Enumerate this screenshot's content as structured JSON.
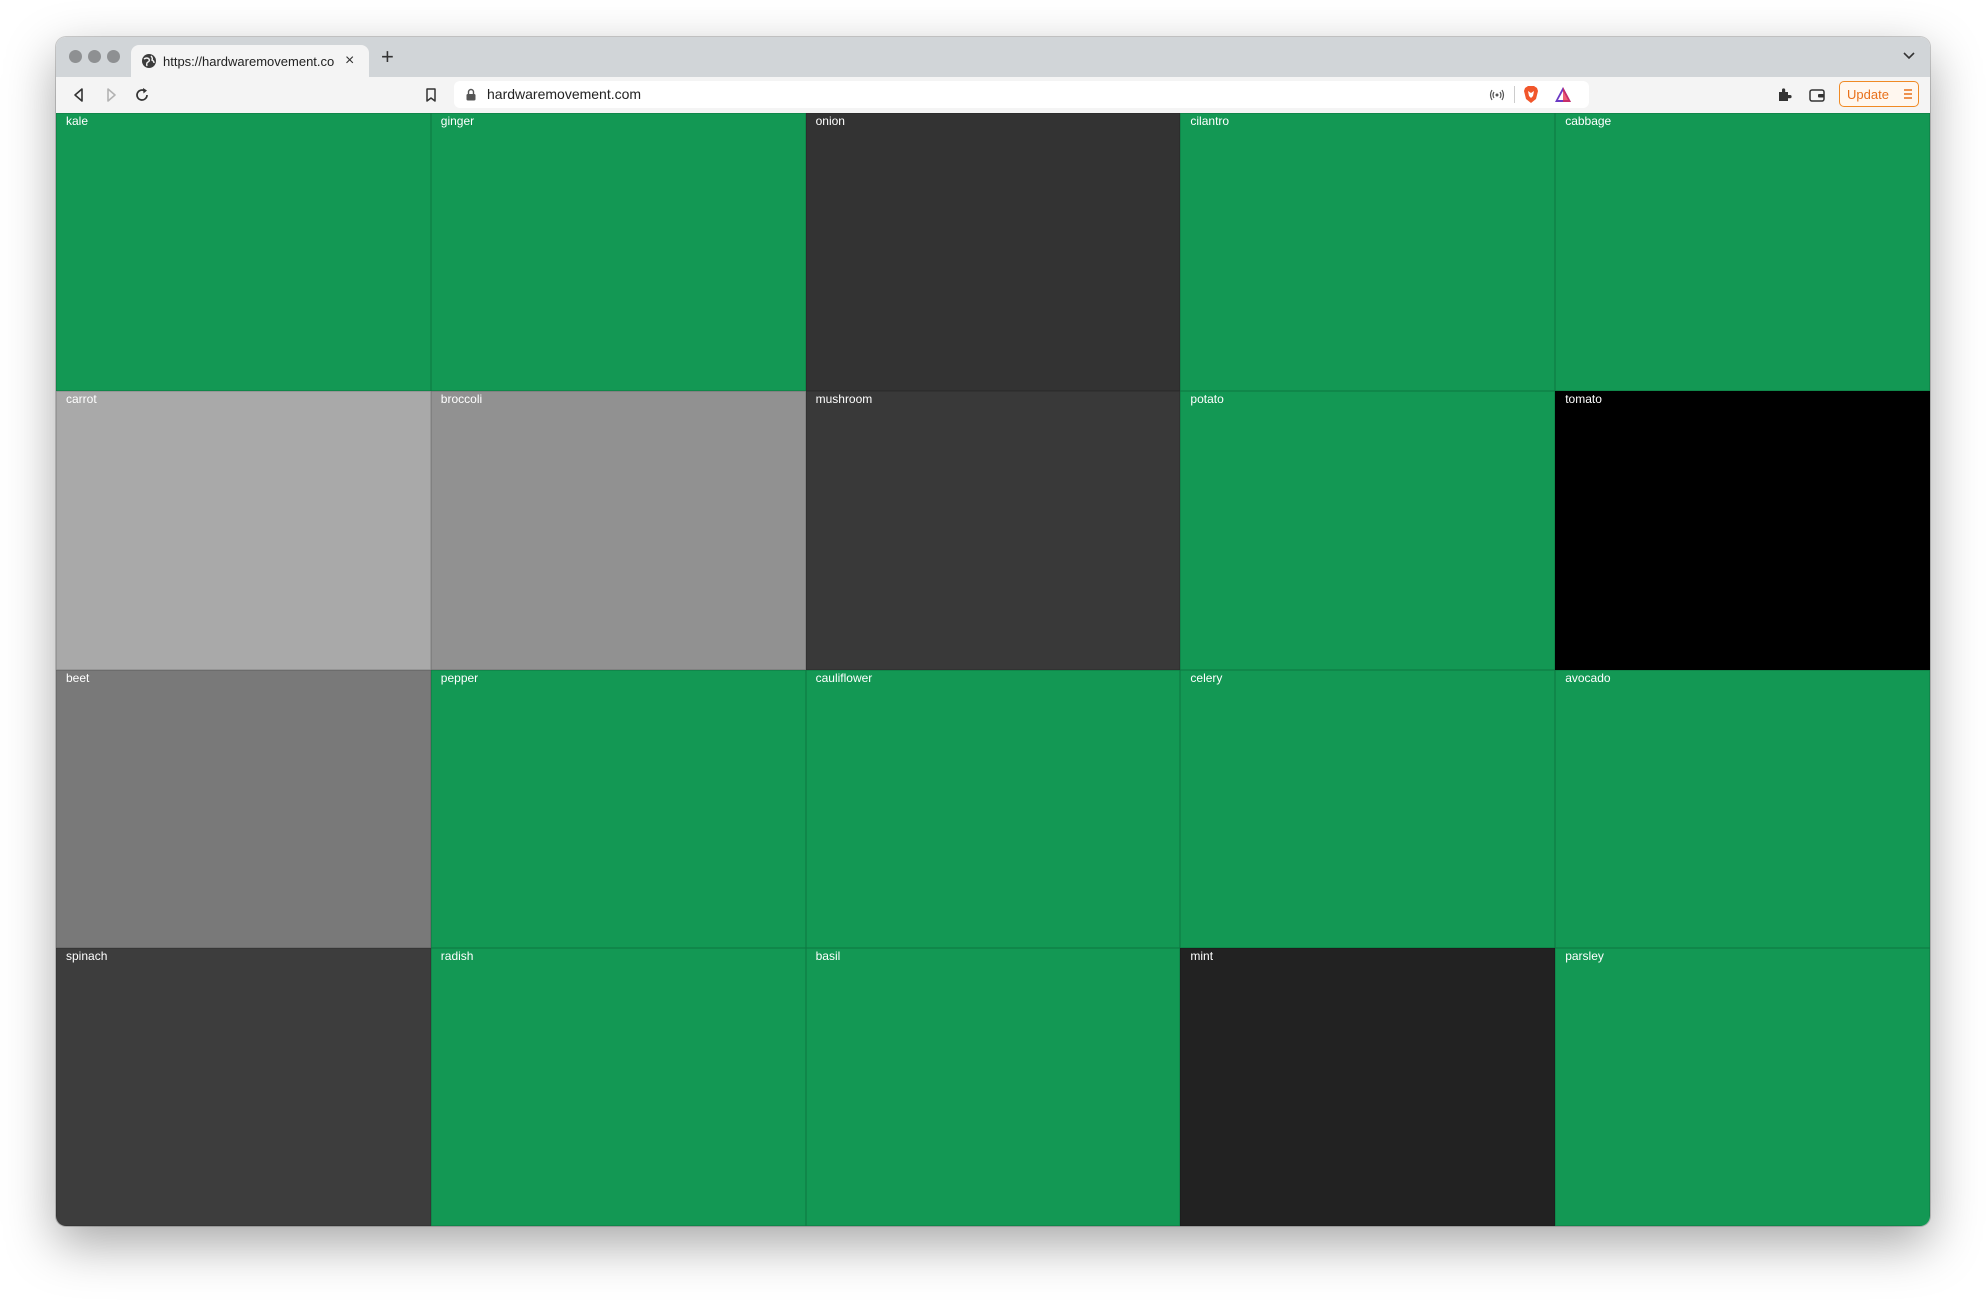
{
  "browser": {
    "tab_title": "https://hardwaremovement.com",
    "new_tab": "+",
    "close_tab": "×",
    "url": "hardwaremovement.com",
    "update_label": "Update"
  },
  "colors": {
    "green": "#139854",
    "dark": "#333333",
    "light_gray": "#a9a9a9",
    "mid_gray": "#919191",
    "dark_gray": "#393939",
    "black": "#000000",
    "gray": "#797979",
    "charcoal": "#3d3d3d",
    "near_black": "#222222",
    "update_accent": "#f08a24"
  },
  "grid": [
    {
      "label": "kale",
      "color": "#139854"
    },
    {
      "label": "ginger",
      "color": "#139854"
    },
    {
      "label": "onion",
      "color": "#333333"
    },
    {
      "label": "cilantro",
      "color": "#139854"
    },
    {
      "label": "cabbage",
      "color": "#139854"
    },
    {
      "label": "carrot",
      "color": "#a9a9a9"
    },
    {
      "label": "broccoli",
      "color": "#919191"
    },
    {
      "label": "mushroom",
      "color": "#393939"
    },
    {
      "label": "potato",
      "color": "#139854"
    },
    {
      "label": "tomato",
      "color": "#000000"
    },
    {
      "label": "beet",
      "color": "#797979"
    },
    {
      "label": "pepper",
      "color": "#139854"
    },
    {
      "label": "cauliflower",
      "color": "#139854"
    },
    {
      "label": "celery",
      "color": "#139854"
    },
    {
      "label": "avocado",
      "color": "#139854"
    },
    {
      "label": "spinach",
      "color": "#3d3d3d"
    },
    {
      "label": "radish",
      "color": "#139854"
    },
    {
      "label": "basil",
      "color": "#139854"
    },
    {
      "label": "mint",
      "color": "#222222"
    },
    {
      "label": "parsley",
      "color": "#139854"
    }
  ]
}
